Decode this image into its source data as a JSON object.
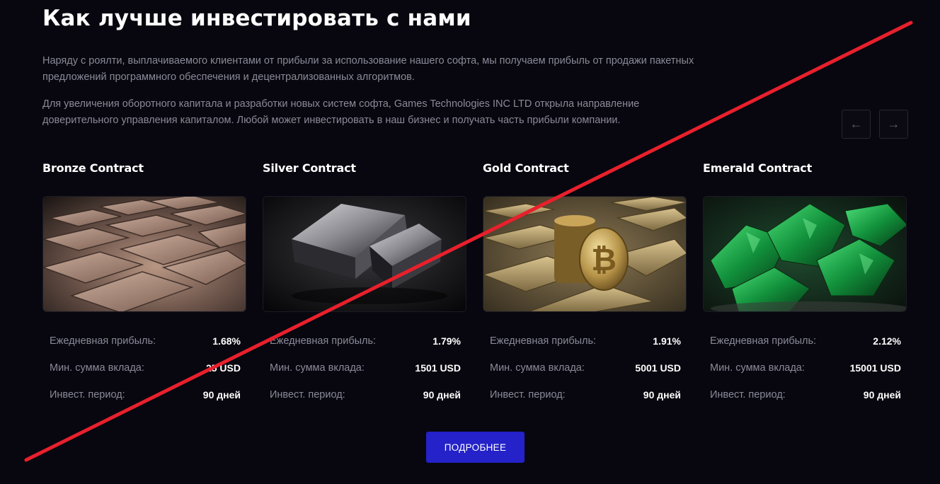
{
  "section": {
    "title": "Как лучше инвестировать с нами",
    "paragraphs": [
      "Наряду с роялти, выплачиваемого клиентами от прибыли за использование нашего софта, мы получаем прибыль от продажи пакетных предложений программного обеспечения и децентрализованных алгоритмов.",
      "Для увеличения оборотного капитала и разработки новых систем софта, Games Technologies INC LTD открыла направление доверительного управления капиталом. Любой может инвестировать в наш бизнес и получать часть прибыли компании."
    ]
  },
  "slider": {
    "prev_icon": "arrow-left-icon",
    "next_icon": "arrow-right-icon",
    "prev_glyph": "←",
    "next_glyph": "→"
  },
  "contracts": [
    {
      "name": "Bronze Contract",
      "image": "bronze-bars",
      "daily_label": "Ежедневная прибыль:",
      "daily": "1.68%",
      "min_label": "Мин. сумма вклада:",
      "min": "25 USD",
      "period_label": "Инвест. период:",
      "period": "90 дней"
    },
    {
      "name": "Silver Contract",
      "image": "silver-bars",
      "daily_label": "Ежедневная прибыль:",
      "daily": "1.79%",
      "min_label": "Мин. сумма вклада:",
      "min": "1501 USD",
      "period_label": "Инвест. период:",
      "period": "90 дней"
    },
    {
      "name": "Gold Contract",
      "image": "gold-bars-bitcoin",
      "daily_label": "Ежедневная прибыль:",
      "daily": "1.91%",
      "min_label": "Мин. сумма вклада:",
      "min": "5001 USD",
      "period_label": "Инвест. период:",
      "period": "90 дней"
    },
    {
      "name": "Emerald Contract",
      "image": "emerald-crystals",
      "daily_label": "Ежедневная прибыль:",
      "daily": "2.12%",
      "min_label": "Мин. сумма вклада:",
      "min": "15001 USD",
      "period_label": "Инвест. период:",
      "period": "90 дней"
    }
  ],
  "cta": {
    "label": "ПОДРОБНЕЕ"
  },
  "colors": {
    "background": "#08070f",
    "button": "#2422c8",
    "muted_text": "#8a8a99",
    "overlay_line": "#e8202c"
  }
}
